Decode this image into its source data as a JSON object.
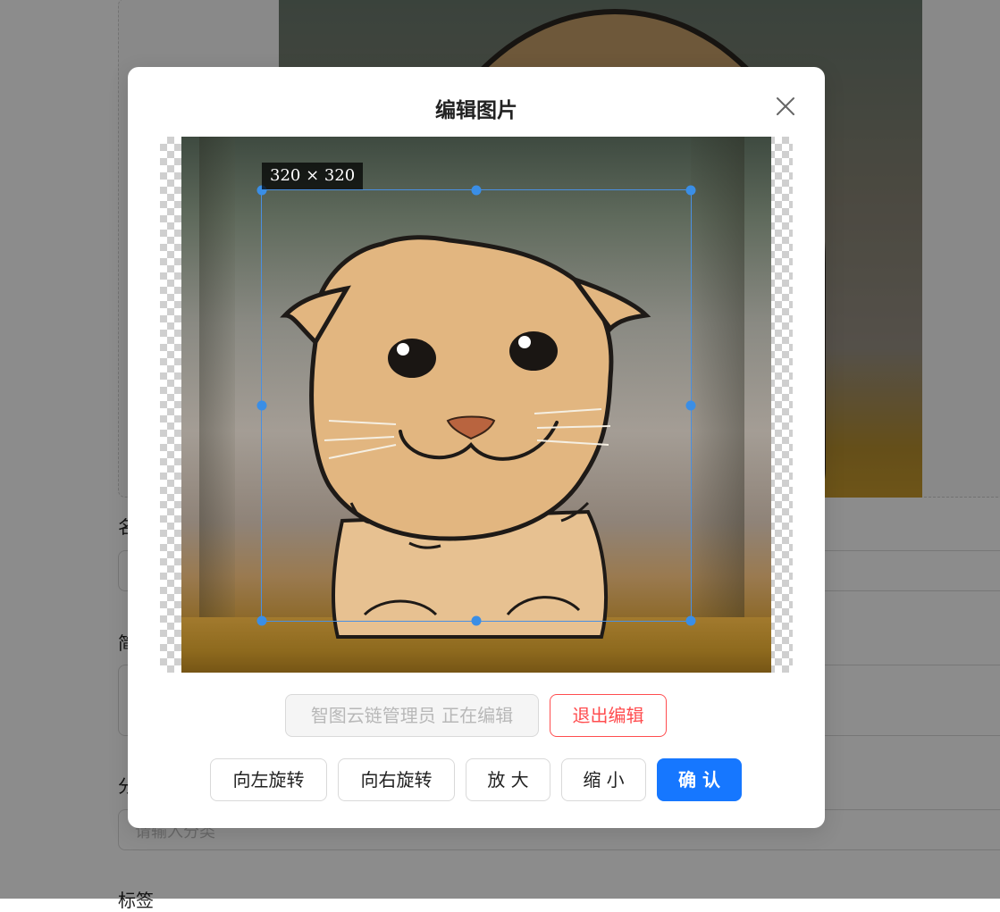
{
  "form": {
    "name_label": "名称",
    "desc_label": "简介",
    "category_label": "分类",
    "category_placeholder": "请输入分类",
    "tags_label": "标签"
  },
  "modal": {
    "title": "编辑图片",
    "close_icon": "close-icon"
  },
  "cropper": {
    "size_label": "320 × 320"
  },
  "editing": {
    "status_button": "智图云链管理员 正在编辑",
    "exit_button": "退出编辑"
  },
  "actions": {
    "rotate_left": "向左旋转",
    "rotate_right": "向右旋转",
    "zoom_in": "放 大",
    "zoom_out": "缩 小",
    "confirm": "确 认"
  },
  "colors": {
    "primary": "#1677ff",
    "danger": "#ff4d4f",
    "crop_handle": "#3a8ee6"
  }
}
